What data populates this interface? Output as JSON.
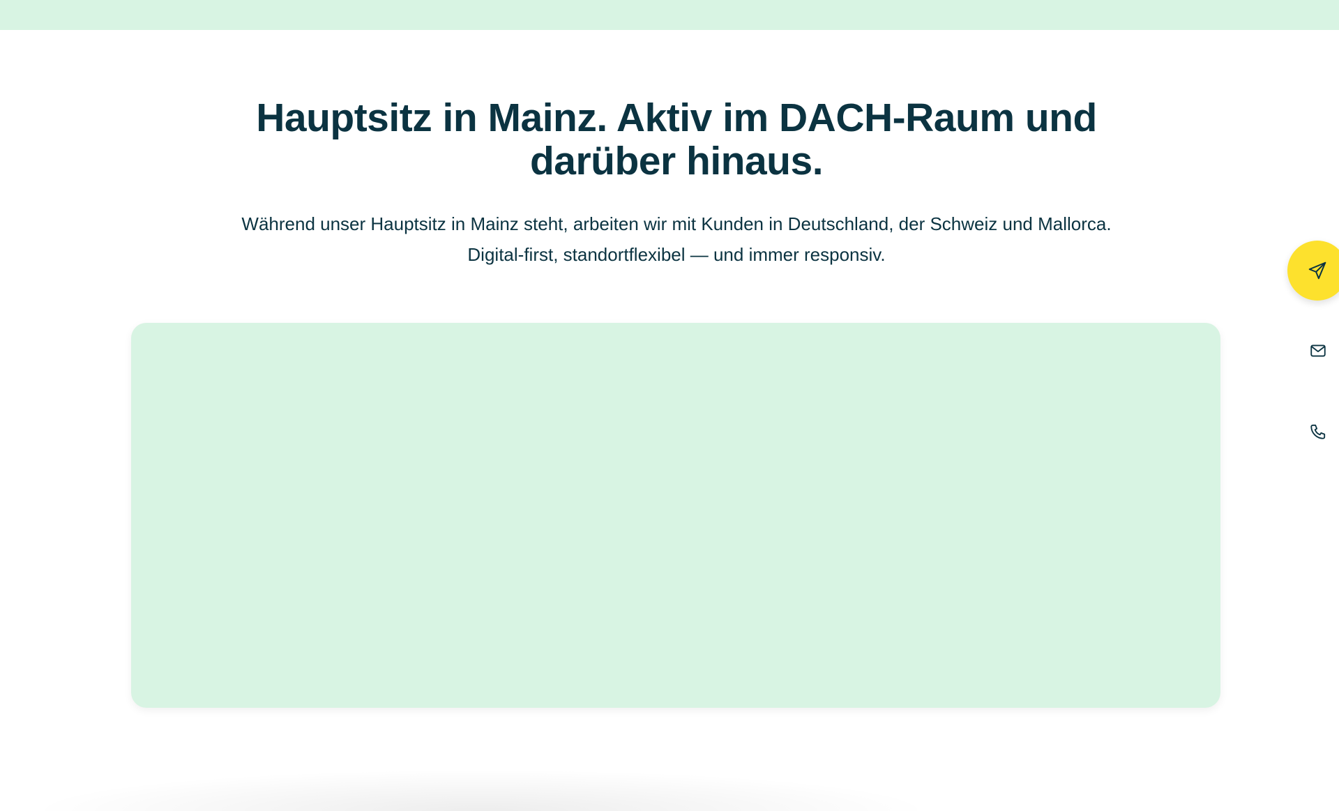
{
  "section": {
    "heading_line1": "Hauptsitz in Mainz. Aktiv im DACH-Raum und",
    "heading_line2": "darüber hinaus.",
    "paragraph_line1": "Während unser Hauptsitz in Mainz steht, arbeiten wir mit Kunden in Deutschland, der Schweiz und Mallorca.",
    "paragraph_line2": "Digital-first, standortflexibel — und immer responsiv."
  },
  "contact_rail": {
    "items": [
      {
        "icon": "send-icon"
      },
      {
        "icon": "mail-icon"
      },
      {
        "icon": "phone-icon"
      }
    ]
  },
  "colors": {
    "mint": "#d8f4e3",
    "dark_teal": "#0b3341",
    "accent_yellow": "#fde12d"
  }
}
